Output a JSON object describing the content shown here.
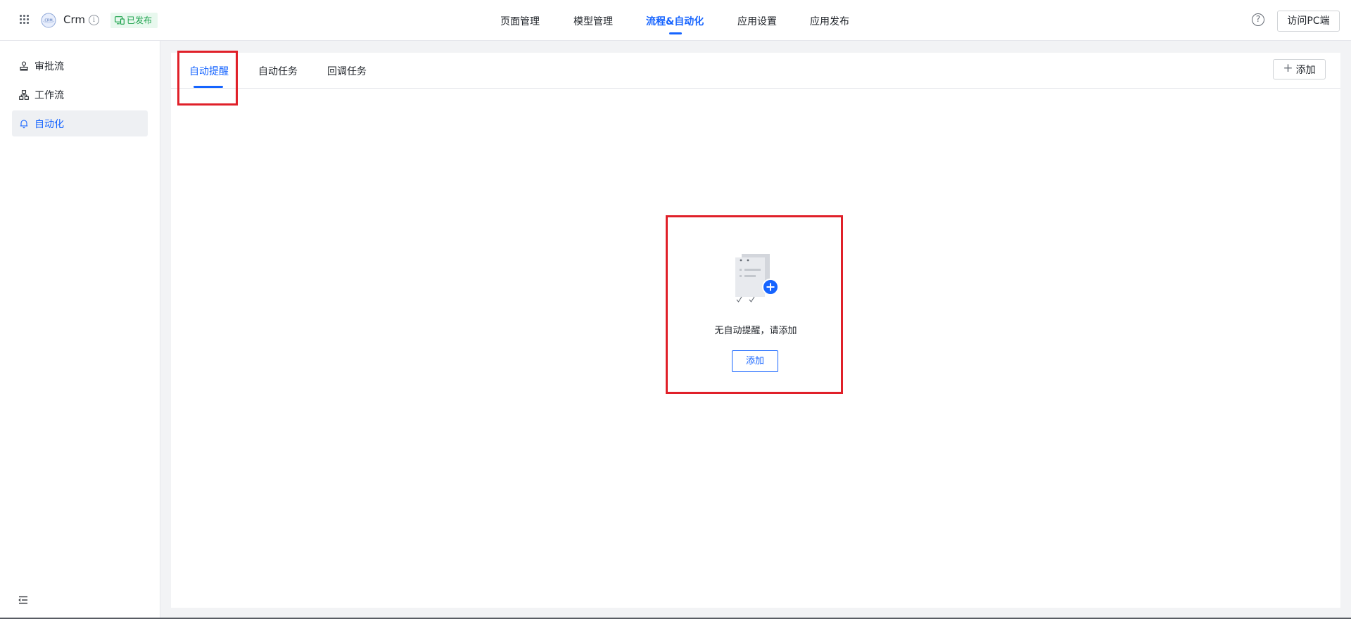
{
  "app": {
    "name": "Crm",
    "logo_text": "CRM",
    "status": "已发布"
  },
  "topnav": {
    "items": [
      {
        "label": "页面管理",
        "active": false
      },
      {
        "label": "模型管理",
        "active": false
      },
      {
        "label": "流程&自动化",
        "active": true
      },
      {
        "label": "应用设置",
        "active": false
      },
      {
        "label": "应用发布",
        "active": false
      }
    ],
    "help_icon": "question-circle-icon",
    "visit_pc_label": "访问PC端"
  },
  "sidebar": {
    "items": [
      {
        "label": "审批流",
        "icon": "stamp-icon",
        "active": false
      },
      {
        "label": "工作流",
        "icon": "workflow-icon",
        "active": false
      },
      {
        "label": "自动化",
        "icon": "bell-icon",
        "active": true
      }
    ],
    "collapse_icon": "collapse-menu-icon"
  },
  "tabs": {
    "items": [
      {
        "label": "自动提醒",
        "active": true
      },
      {
        "label": "自动任务",
        "active": false
      },
      {
        "label": "回调任务",
        "active": false
      }
    ],
    "add_label": "添加"
  },
  "empty_state": {
    "message": "无自动提醒，请添加",
    "add_label": "添加"
  },
  "colors": {
    "accent": "#1664ff",
    "status_green": "#1aa14a",
    "highlight_red": "#e02029"
  }
}
